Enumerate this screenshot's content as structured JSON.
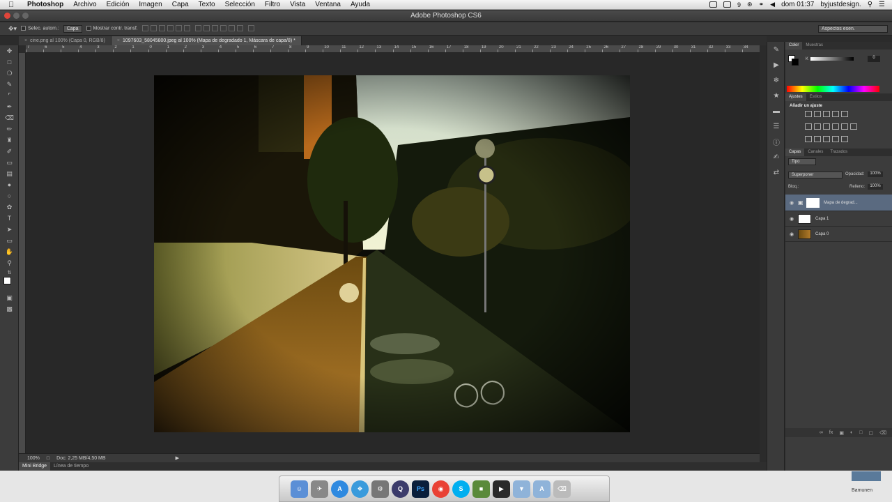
{
  "menubar": {
    "app": "Photoshop",
    "items": [
      "Archivo",
      "Edición",
      "Imagen",
      "Capa",
      "Texto",
      "Selección",
      "Filtro",
      "Vista",
      "Ventana",
      "Ayuda"
    ],
    "battery_count": "9",
    "clock": "dom 01:37",
    "user": "byjustdesign."
  },
  "window": {
    "title": "Adobe Photoshop CS6"
  },
  "options": {
    "auto_select": "Selec. autom.:",
    "auto_select_value": "Capa",
    "transform": "Mostrar contr. transf.",
    "workspace": "Aspectos esen."
  },
  "tabs": [
    {
      "label": "cine.png al 100% (Capa 0, RGB/8)",
      "active": false
    },
    {
      "label": "1097603_58045800.jpeg al 100% (Mapa de degradado 1, Máscara de capa/8) *",
      "active": true
    }
  ],
  "ruler": [
    "7",
    "6",
    "5",
    "4",
    "3",
    "2",
    "1",
    "0",
    "1",
    "2",
    "3",
    "4",
    "5",
    "6",
    "7",
    "8",
    "9",
    "10",
    "11",
    "12",
    "13",
    "14",
    "15",
    "16",
    "17",
    "18",
    "19",
    "20",
    "21",
    "22",
    "23",
    "24",
    "25",
    "26",
    "27",
    "28",
    "29",
    "30",
    "31",
    "32",
    "33",
    "34"
  ],
  "status": {
    "zoom": "100%",
    "doc": "Doc: 2,25 MB/4,50 MB"
  },
  "bottom_tabs": [
    "Mini Bridge",
    "Línea de tiempo"
  ],
  "color_panel": {
    "tabs": [
      "Color",
      "Muestras"
    ],
    "k_label": "K",
    "k_value": "0"
  },
  "adjustments_panel": {
    "tabs": [
      "Ajustes",
      "Estilos"
    ],
    "heading": "Añadir un ajuste"
  },
  "layers_panel": {
    "tabs": [
      "Capas",
      "Canales",
      "Trazados"
    ],
    "filter": "Tipo",
    "blend_mode": "Superponer",
    "opacity_label": "Opacidad:",
    "opacity": "100%",
    "lock_label": "Bloq.:",
    "fill_label": "Relleno:",
    "fill": "100%",
    "layers": [
      {
        "name": "Mapa de degrad...",
        "selected": true
      },
      {
        "name": "Capa 1",
        "selected": false
      },
      {
        "name": "Capa 0",
        "selected": false
      }
    ]
  },
  "dock": {
    "ps_label": "Ps"
  },
  "desktop": {
    "label": "Bamunen"
  }
}
